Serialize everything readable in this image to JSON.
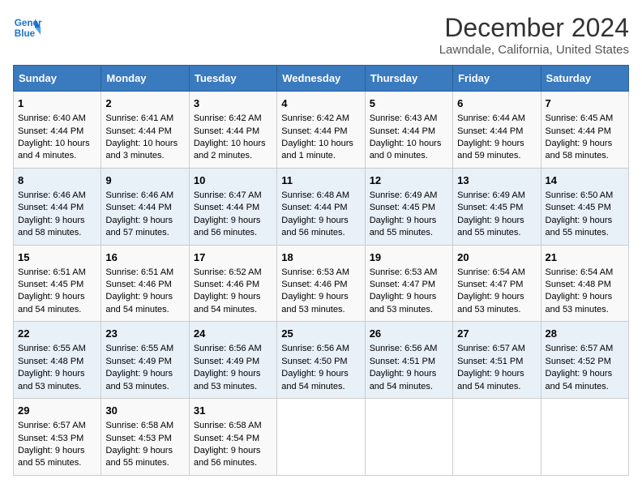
{
  "header": {
    "logo_line1": "General",
    "logo_line2": "Blue",
    "title": "December 2024",
    "subtitle": "Lawndale, California, United States"
  },
  "columns": [
    "Sunday",
    "Monday",
    "Tuesday",
    "Wednesday",
    "Thursday",
    "Friday",
    "Saturday"
  ],
  "weeks": [
    [
      {
        "day": "1",
        "lines": [
          "Sunrise: 6:40 AM",
          "Sunset: 4:44 PM",
          "Daylight: 10 hours",
          "and 4 minutes."
        ]
      },
      {
        "day": "2",
        "lines": [
          "Sunrise: 6:41 AM",
          "Sunset: 4:44 PM",
          "Daylight: 10 hours",
          "and 3 minutes."
        ]
      },
      {
        "day": "3",
        "lines": [
          "Sunrise: 6:42 AM",
          "Sunset: 4:44 PM",
          "Daylight: 10 hours",
          "and 2 minutes."
        ]
      },
      {
        "day": "4",
        "lines": [
          "Sunrise: 6:42 AM",
          "Sunset: 4:44 PM",
          "Daylight: 10 hours",
          "and 1 minute."
        ]
      },
      {
        "day": "5",
        "lines": [
          "Sunrise: 6:43 AM",
          "Sunset: 4:44 PM",
          "Daylight: 10 hours",
          "and 0 minutes."
        ]
      },
      {
        "day": "6",
        "lines": [
          "Sunrise: 6:44 AM",
          "Sunset: 4:44 PM",
          "Daylight: 9 hours",
          "and 59 minutes."
        ]
      },
      {
        "day": "7",
        "lines": [
          "Sunrise: 6:45 AM",
          "Sunset: 4:44 PM",
          "Daylight: 9 hours",
          "and 58 minutes."
        ]
      }
    ],
    [
      {
        "day": "8",
        "lines": [
          "Sunrise: 6:46 AM",
          "Sunset: 4:44 PM",
          "Daylight: 9 hours",
          "and 58 minutes."
        ]
      },
      {
        "day": "9",
        "lines": [
          "Sunrise: 6:46 AM",
          "Sunset: 4:44 PM",
          "Daylight: 9 hours",
          "and 57 minutes."
        ]
      },
      {
        "day": "10",
        "lines": [
          "Sunrise: 6:47 AM",
          "Sunset: 4:44 PM",
          "Daylight: 9 hours",
          "and 56 minutes."
        ]
      },
      {
        "day": "11",
        "lines": [
          "Sunrise: 6:48 AM",
          "Sunset: 4:44 PM",
          "Daylight: 9 hours",
          "and 56 minutes."
        ]
      },
      {
        "day": "12",
        "lines": [
          "Sunrise: 6:49 AM",
          "Sunset: 4:45 PM",
          "Daylight: 9 hours",
          "and 55 minutes."
        ]
      },
      {
        "day": "13",
        "lines": [
          "Sunrise: 6:49 AM",
          "Sunset: 4:45 PM",
          "Daylight: 9 hours",
          "and 55 minutes."
        ]
      },
      {
        "day": "14",
        "lines": [
          "Sunrise: 6:50 AM",
          "Sunset: 4:45 PM",
          "Daylight: 9 hours",
          "and 55 minutes."
        ]
      }
    ],
    [
      {
        "day": "15",
        "lines": [
          "Sunrise: 6:51 AM",
          "Sunset: 4:45 PM",
          "Daylight: 9 hours",
          "and 54 minutes."
        ]
      },
      {
        "day": "16",
        "lines": [
          "Sunrise: 6:51 AM",
          "Sunset: 4:46 PM",
          "Daylight: 9 hours",
          "and 54 minutes."
        ]
      },
      {
        "day": "17",
        "lines": [
          "Sunrise: 6:52 AM",
          "Sunset: 4:46 PM",
          "Daylight: 9 hours",
          "and 54 minutes."
        ]
      },
      {
        "day": "18",
        "lines": [
          "Sunrise: 6:53 AM",
          "Sunset: 4:46 PM",
          "Daylight: 9 hours",
          "and 53 minutes."
        ]
      },
      {
        "day": "19",
        "lines": [
          "Sunrise: 6:53 AM",
          "Sunset: 4:47 PM",
          "Daylight: 9 hours",
          "and 53 minutes."
        ]
      },
      {
        "day": "20",
        "lines": [
          "Sunrise: 6:54 AM",
          "Sunset: 4:47 PM",
          "Daylight: 9 hours",
          "and 53 minutes."
        ]
      },
      {
        "day": "21",
        "lines": [
          "Sunrise: 6:54 AM",
          "Sunset: 4:48 PM",
          "Daylight: 9 hours",
          "and 53 minutes."
        ]
      }
    ],
    [
      {
        "day": "22",
        "lines": [
          "Sunrise: 6:55 AM",
          "Sunset: 4:48 PM",
          "Daylight: 9 hours",
          "and 53 minutes."
        ]
      },
      {
        "day": "23",
        "lines": [
          "Sunrise: 6:55 AM",
          "Sunset: 4:49 PM",
          "Daylight: 9 hours",
          "and 53 minutes."
        ]
      },
      {
        "day": "24",
        "lines": [
          "Sunrise: 6:56 AM",
          "Sunset: 4:49 PM",
          "Daylight: 9 hours",
          "and 53 minutes."
        ]
      },
      {
        "day": "25",
        "lines": [
          "Sunrise: 6:56 AM",
          "Sunset: 4:50 PM",
          "Daylight: 9 hours",
          "and 54 minutes."
        ]
      },
      {
        "day": "26",
        "lines": [
          "Sunrise: 6:56 AM",
          "Sunset: 4:51 PM",
          "Daylight: 9 hours",
          "and 54 minutes."
        ]
      },
      {
        "day": "27",
        "lines": [
          "Sunrise: 6:57 AM",
          "Sunset: 4:51 PM",
          "Daylight: 9 hours",
          "and 54 minutes."
        ]
      },
      {
        "day": "28",
        "lines": [
          "Sunrise: 6:57 AM",
          "Sunset: 4:52 PM",
          "Daylight: 9 hours",
          "and 54 minutes."
        ]
      }
    ],
    [
      {
        "day": "29",
        "lines": [
          "Sunrise: 6:57 AM",
          "Sunset: 4:53 PM",
          "Daylight: 9 hours",
          "and 55 minutes."
        ]
      },
      {
        "day": "30",
        "lines": [
          "Sunrise: 6:58 AM",
          "Sunset: 4:53 PM",
          "Daylight: 9 hours",
          "and 55 minutes."
        ]
      },
      {
        "day": "31",
        "lines": [
          "Sunrise: 6:58 AM",
          "Sunset: 4:54 PM",
          "Daylight: 9 hours",
          "and 56 minutes."
        ]
      },
      null,
      null,
      null,
      null
    ]
  ]
}
